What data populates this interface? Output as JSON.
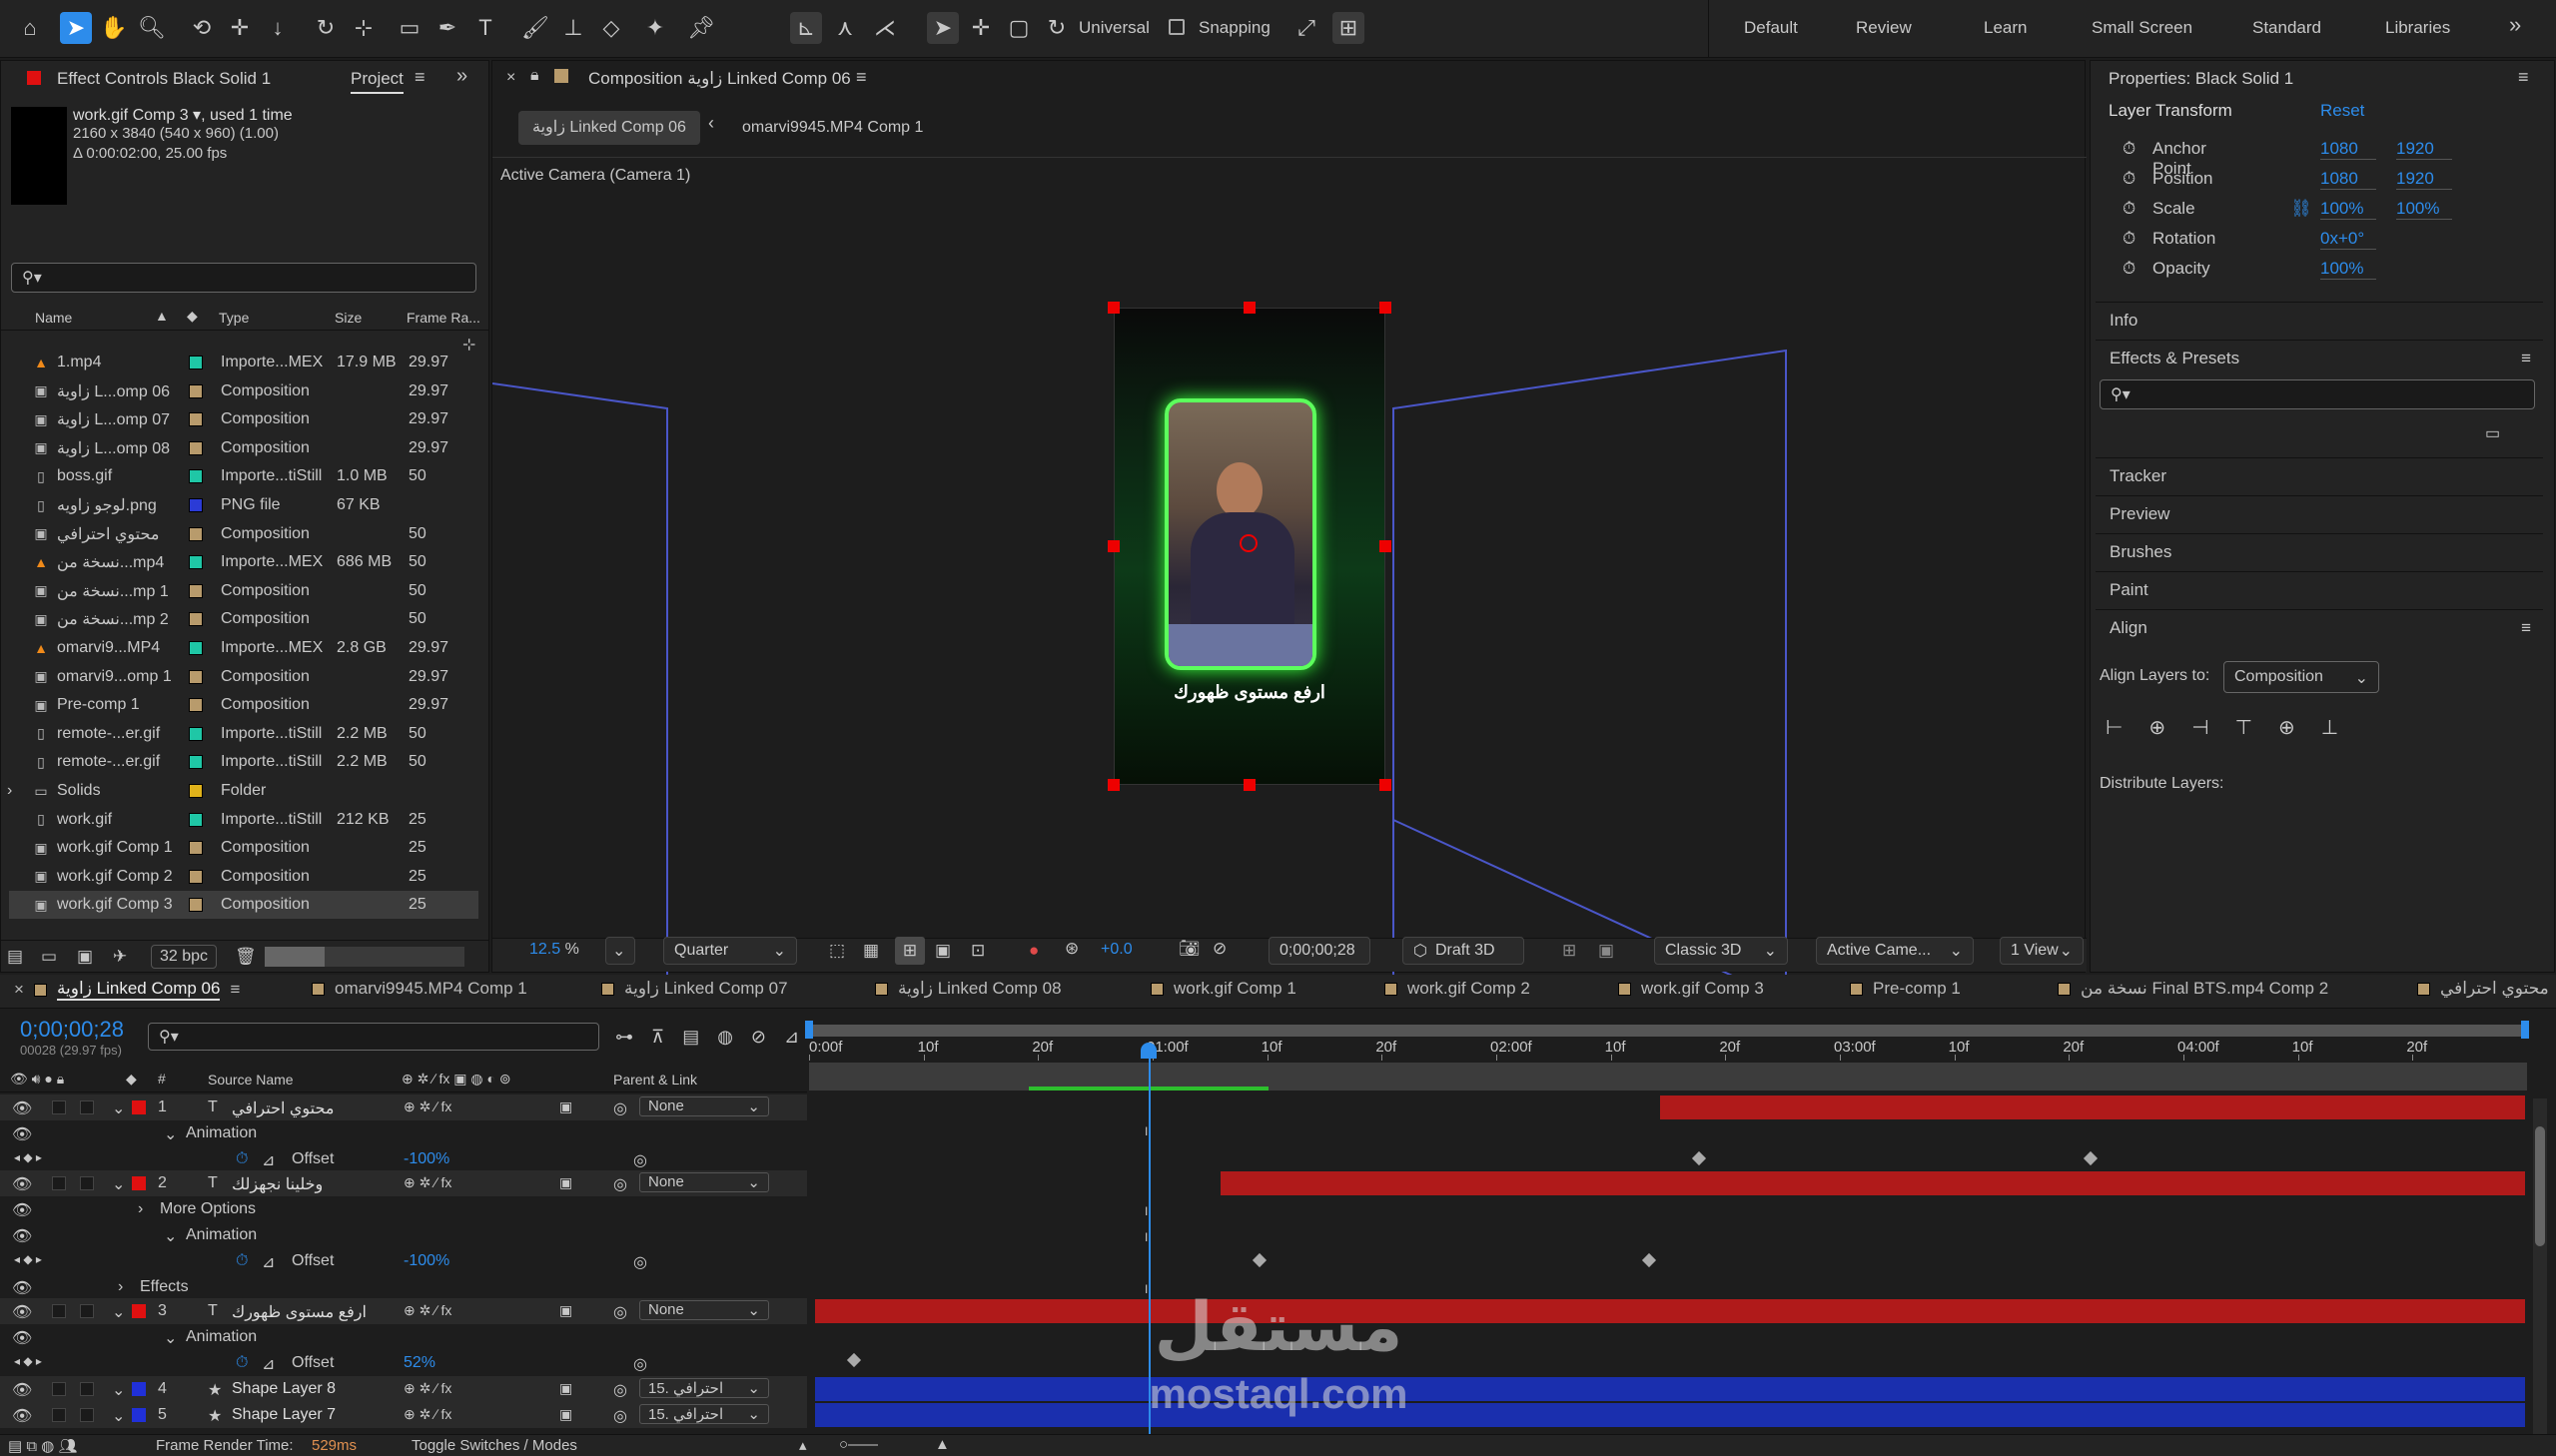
{
  "toolbar": {
    "universal": "Universal",
    "snapping": "Snapping",
    "workspaces": [
      "Default",
      "Review",
      "Learn",
      "Small Screen",
      "Standard",
      "Libraries"
    ],
    "more": "»"
  },
  "left_panel": {
    "tab1": "Effect Controls Black Solid 1",
    "tab2": "Project",
    "item_name": "work.gif Comp 3",
    "item_used": ", used 1 time",
    "item_dims": "2160 x 3840  (540 x 960) (1.00)",
    "item_dur": "Δ 0:00:02:00, 25.00 fps",
    "search_placeholder": "",
    "columns": {
      "name": "Name",
      "type": "Type",
      "size": "Size",
      "frame_rate": "Frame Ra..."
    },
    "items": [
      {
        "icon": "vlc-icon",
        "name": "1.mp4",
        "label": "#1fc7a6",
        "type": "Importe...MEX",
        "size": "17.9 MB",
        "fps": "29.97"
      },
      {
        "icon": "composition-icon",
        "name": "زاوية L...omp 06",
        "label": "#b89b6c",
        "type": "Composition",
        "size": "",
        "fps": "29.97"
      },
      {
        "icon": "composition-icon",
        "name": "زاوية L...omp 07",
        "label": "#b89b6c",
        "type": "Composition",
        "size": "",
        "fps": "29.97"
      },
      {
        "icon": "composition-icon",
        "name": "زاوية L...omp 08",
        "label": "#b89b6c",
        "type": "Composition",
        "size": "",
        "fps": "29.97"
      },
      {
        "icon": "gif-file-icon",
        "name": "boss.gif",
        "label": "#1fc7a6",
        "type": "Importe...tiStill",
        "size": "1.0 MB",
        "fps": "50"
      },
      {
        "icon": "png-file-icon",
        "name": "لوجو زاويه.png",
        "label": "#2b3bd6",
        "type": "PNG file",
        "size": "67 KB",
        "fps": ""
      },
      {
        "icon": "composition-icon",
        "name": "محتوي احترافي",
        "label": "#b89b6c",
        "type": "Composition",
        "size": "",
        "fps": "50"
      },
      {
        "icon": "vlc-icon",
        "name": "نسخة من...mp4",
        "label": "#1fc7a6",
        "type": "Importe...MEX",
        "size": "686 MB",
        "fps": "50"
      },
      {
        "icon": "composition-icon",
        "name": "نسخة من...mp 1",
        "label": "#b89b6c",
        "type": "Composition",
        "size": "",
        "fps": "50"
      },
      {
        "icon": "composition-icon",
        "name": "نسخة من...mp 2",
        "label": "#b89b6c",
        "type": "Composition",
        "size": "",
        "fps": "50"
      },
      {
        "icon": "vlc-icon",
        "name": "omarvi9...MP4",
        "label": "#1fc7a6",
        "type": "Importe...MEX",
        "size": "2.8 GB",
        "fps": "29.97"
      },
      {
        "icon": "composition-icon",
        "name": "omarvi9...omp 1",
        "label": "#b89b6c",
        "type": "Composition",
        "size": "",
        "fps": "29.97"
      },
      {
        "icon": "composition-icon",
        "name": "Pre-comp 1",
        "label": "#b89b6c",
        "type": "Composition",
        "size": "",
        "fps": "29.97"
      },
      {
        "icon": "gif-file-icon",
        "name": "remote-...er.gif",
        "label": "#1fc7a6",
        "type": "Importe...tiStill",
        "size": "2.2 MB",
        "fps": "50"
      },
      {
        "icon": "gif-file-icon",
        "name": "remote-...er.gif",
        "label": "#1fc7a6",
        "type": "Importe...tiStill",
        "size": "2.2 MB",
        "fps": "50"
      },
      {
        "icon": "folder-icon",
        "name": "Solids",
        "label": "#e0b21a",
        "type": "Folder",
        "size": "",
        "fps": ""
      },
      {
        "icon": "gif-file-icon",
        "name": "work.gif",
        "label": "#1fc7a6",
        "type": "Importe...tiStill",
        "size": "212 KB",
        "fps": "25"
      },
      {
        "icon": "composition-icon",
        "name": "work.gif Comp 1",
        "label": "#b89b6c",
        "type": "Composition",
        "size": "",
        "fps": "25"
      },
      {
        "icon": "composition-icon",
        "name": "work.gif Comp 2",
        "label": "#b89b6c",
        "type": "Composition",
        "size": "",
        "fps": "25"
      },
      {
        "icon": "composition-icon",
        "name": "work.gif Comp 3",
        "label": "#b89b6c",
        "type": "Composition",
        "size": "",
        "fps": "25"
      }
    ],
    "bpc": "32 bpc"
  },
  "viewer": {
    "tab_title": "Composition زاوية Linked Comp 06",
    "breadcrumb1": "زاوية Linked Comp 06",
    "breadcrumb2": "omarvi9945.MP4 Comp 1",
    "camera_label": "Active Camera (Camera 1)",
    "caption": "ارفع مستوى ظهورك",
    "zoom": "12.5",
    "zoom_unit": "%",
    "resolution": "Quarter",
    "exposure": "+0.0",
    "timecode": "0;00;00;28",
    "draft": "Draft 3D",
    "renderer": "Classic 3D",
    "camera_select": "Active Came...",
    "view": "1 View"
  },
  "properties": {
    "title": "Properties: Black Solid 1",
    "section": "Layer Transform",
    "reset": "Reset",
    "rows": [
      {
        "label": "Anchor Point",
        "v1": "1080",
        "v2": "1920"
      },
      {
        "label": "Position",
        "v1": "1080",
        "v2": "1920"
      },
      {
        "label": "Scale",
        "v1": "100%",
        "v2": "100%"
      },
      {
        "label": "Rotation",
        "v1": "0x+0°",
        "v2": ""
      },
      {
        "label": "Opacity",
        "v1": "100%",
        "v2": ""
      }
    ],
    "info": "Info",
    "effects_presets": "Effects & Presets",
    "tracker": "Tracker",
    "preview": "Preview",
    "brushes": "Brushes",
    "paint": "Paint",
    "align": "Align",
    "align_layers_to": "Align Layers to:",
    "align_target": "Composition",
    "distribute": "Distribute Layers:"
  },
  "timeline": {
    "tabs": [
      "زاوية Linked Comp 06",
      "omarvi9945.MP4 Comp 1",
      "زاوية Linked Comp 07",
      "زاوية Linked Comp 08",
      "work.gif Comp 1",
      "work.gif Comp 2",
      "work.gif Comp 3",
      "Pre-comp 1",
      "نسخة من Final BTS.mp4 Comp 2",
      "محتوي احترافي"
    ],
    "timecode": "0;00;00;28",
    "timecode_sub": "00028 (29.97 fps)",
    "header": {
      "num": "#",
      "source": "Source Name",
      "parent": "Parent & Link"
    },
    "ruler": [
      "0:00f",
      "10f",
      "20f",
      "01:00f",
      "10f",
      "20f",
      "02:00f",
      "10f",
      "20f",
      "03:00f",
      "10f",
      "20f",
      "04:00f",
      "10f",
      "20f"
    ],
    "rows": [
      {
        "kind": "layer",
        "num": "1",
        "type": "T",
        "name": "محتوي احترافي",
        "label": "#e01010",
        "parent": "None"
      },
      {
        "kind": "group",
        "name": "Animation"
      },
      {
        "kind": "prop",
        "name": "Offset",
        "value": "-100%"
      },
      {
        "kind": "layer",
        "num": "2",
        "type": "T",
        "name": "وخلينا نجهزلك",
        "label": "#e01010",
        "parent": "None"
      },
      {
        "kind": "group",
        "name": "More Options"
      },
      {
        "kind": "group",
        "name": "Animation"
      },
      {
        "kind": "prop",
        "name": "Offset",
        "value": "-100%"
      },
      {
        "kind": "group",
        "name": "Effects"
      },
      {
        "kind": "layer",
        "num": "3",
        "type": "T",
        "name": "ارفع مستوى ظهورك",
        "label": "#e01010",
        "parent": "None"
      },
      {
        "kind": "group",
        "name": "Animation"
      },
      {
        "kind": "prop",
        "name": "Offset",
        "value": "52%"
      },
      {
        "kind": "layer",
        "num": "4",
        "type": "★",
        "name": "Shape Layer 8",
        "label": "#2030d8",
        "parent": "15. احترافي"
      },
      {
        "kind": "layer",
        "num": "5",
        "type": "★",
        "name": "Shape Layer 7",
        "label": "#2030d8",
        "parent": "15. احترافي"
      }
    ],
    "render_time_label": "Frame Render Time:",
    "render_time": "529ms",
    "toggle": "Toggle Switches / Modes"
  },
  "watermark": {
    "logo": "مستقل",
    "url": "mostaql.com"
  },
  "colors": {
    "accent": "#2d8ceb",
    "red_bar": "#b01a1a",
    "blue_bar": "#1a2fae",
    "label_red": "#e01010"
  }
}
